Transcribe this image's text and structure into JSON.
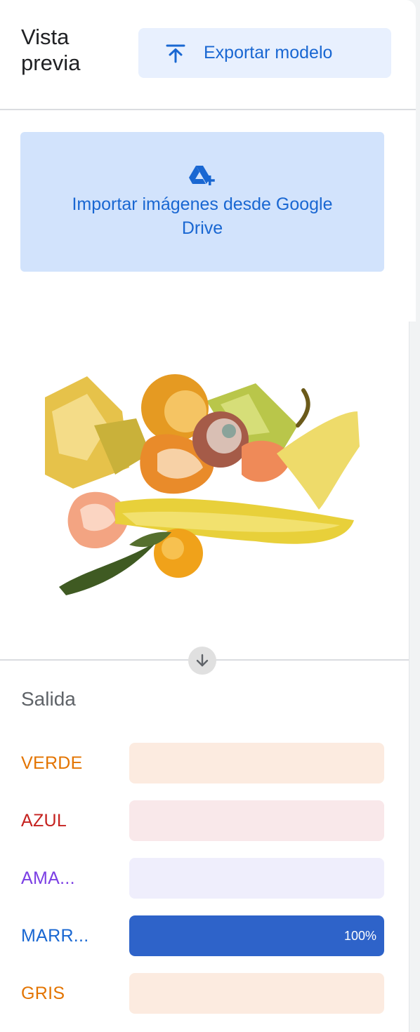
{
  "header": {
    "title": "Vista previa",
    "export_label": "Exportar modelo",
    "export_icon": "upload-icon"
  },
  "import": {
    "label": "Importar imágenes desde Google Drive",
    "icon": "google-drive-add-icon"
  },
  "preview": {
    "scroll_icon": "arrow-down-icon"
  },
  "output": {
    "title": "Salida",
    "classes": [
      {
        "label": "VERDE",
        "value": 0,
        "percent_text": "",
        "label_color": "#e37400",
        "track_color": "#fcebe0",
        "fill_color": "#e8710a"
      },
      {
        "label": "AZUL",
        "value": 0,
        "percent_text": "",
        "label_color": "#c5221f",
        "track_color": "#f9e8ea",
        "fill_color": "#d93f62"
      },
      {
        "label": "AMA...",
        "value": 0,
        "percent_text": "",
        "label_color": "#7b3fe4",
        "track_color": "#efeefc",
        "fill_color": "#7b3fe4"
      },
      {
        "label": "MARR...",
        "value": 1,
        "percent_text": "100%",
        "label_color": "#1967d2",
        "track_color": "#dbe7fb",
        "fill_color": "#2e63c9"
      },
      {
        "label": "GRIS",
        "value": 0,
        "percent_text": "",
        "label_color": "#e37400",
        "track_color": "#fcebe0",
        "fill_color": "#e8710a"
      }
    ]
  }
}
